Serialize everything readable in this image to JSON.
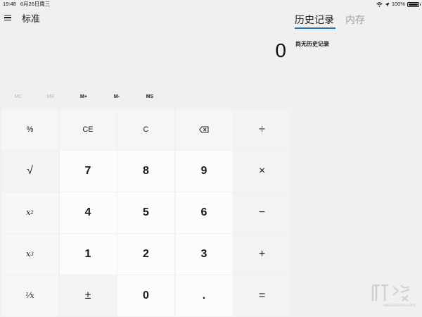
{
  "status_bar": {
    "time": "19:48",
    "date": "6月26日周三",
    "battery": "100%",
    "battery_level": 1.0
  },
  "header": {
    "mode_title": "标准"
  },
  "display": {
    "value": "0"
  },
  "panel": {
    "tabs": [
      {
        "label": "历史记录",
        "active": true
      },
      {
        "label": "内存",
        "active": false
      }
    ],
    "empty_message": "尚无历史记录",
    "accent_color": "#1f6fb5"
  },
  "memory": {
    "buttons": [
      {
        "label": "MC",
        "enabled": false
      },
      {
        "label": "MR",
        "enabled": false
      },
      {
        "label": "M+",
        "enabled": true
      },
      {
        "label": "M-",
        "enabled": true
      },
      {
        "label": "MS",
        "enabled": true
      }
    ]
  },
  "keypad": {
    "percent": "%",
    "ce": "CE",
    "c": "C",
    "backspace_icon": "backspace-icon",
    "divide": "÷",
    "sqrt": "√",
    "seven": "7",
    "eight": "8",
    "nine": "9",
    "multiply": "×",
    "square_base": "x",
    "square_exp": "2",
    "four": "4",
    "five": "5",
    "six": "6",
    "minus": "−",
    "cube_base": "x",
    "cube_exp": "3",
    "one": "1",
    "two": "2",
    "three": "3",
    "plus": "+",
    "reciprocal": "¹⁄x",
    "negate": "±",
    "zero": "0",
    "decimal": ".",
    "equals": "="
  },
  "watermark": {
    "url": "www.ithome.com"
  }
}
